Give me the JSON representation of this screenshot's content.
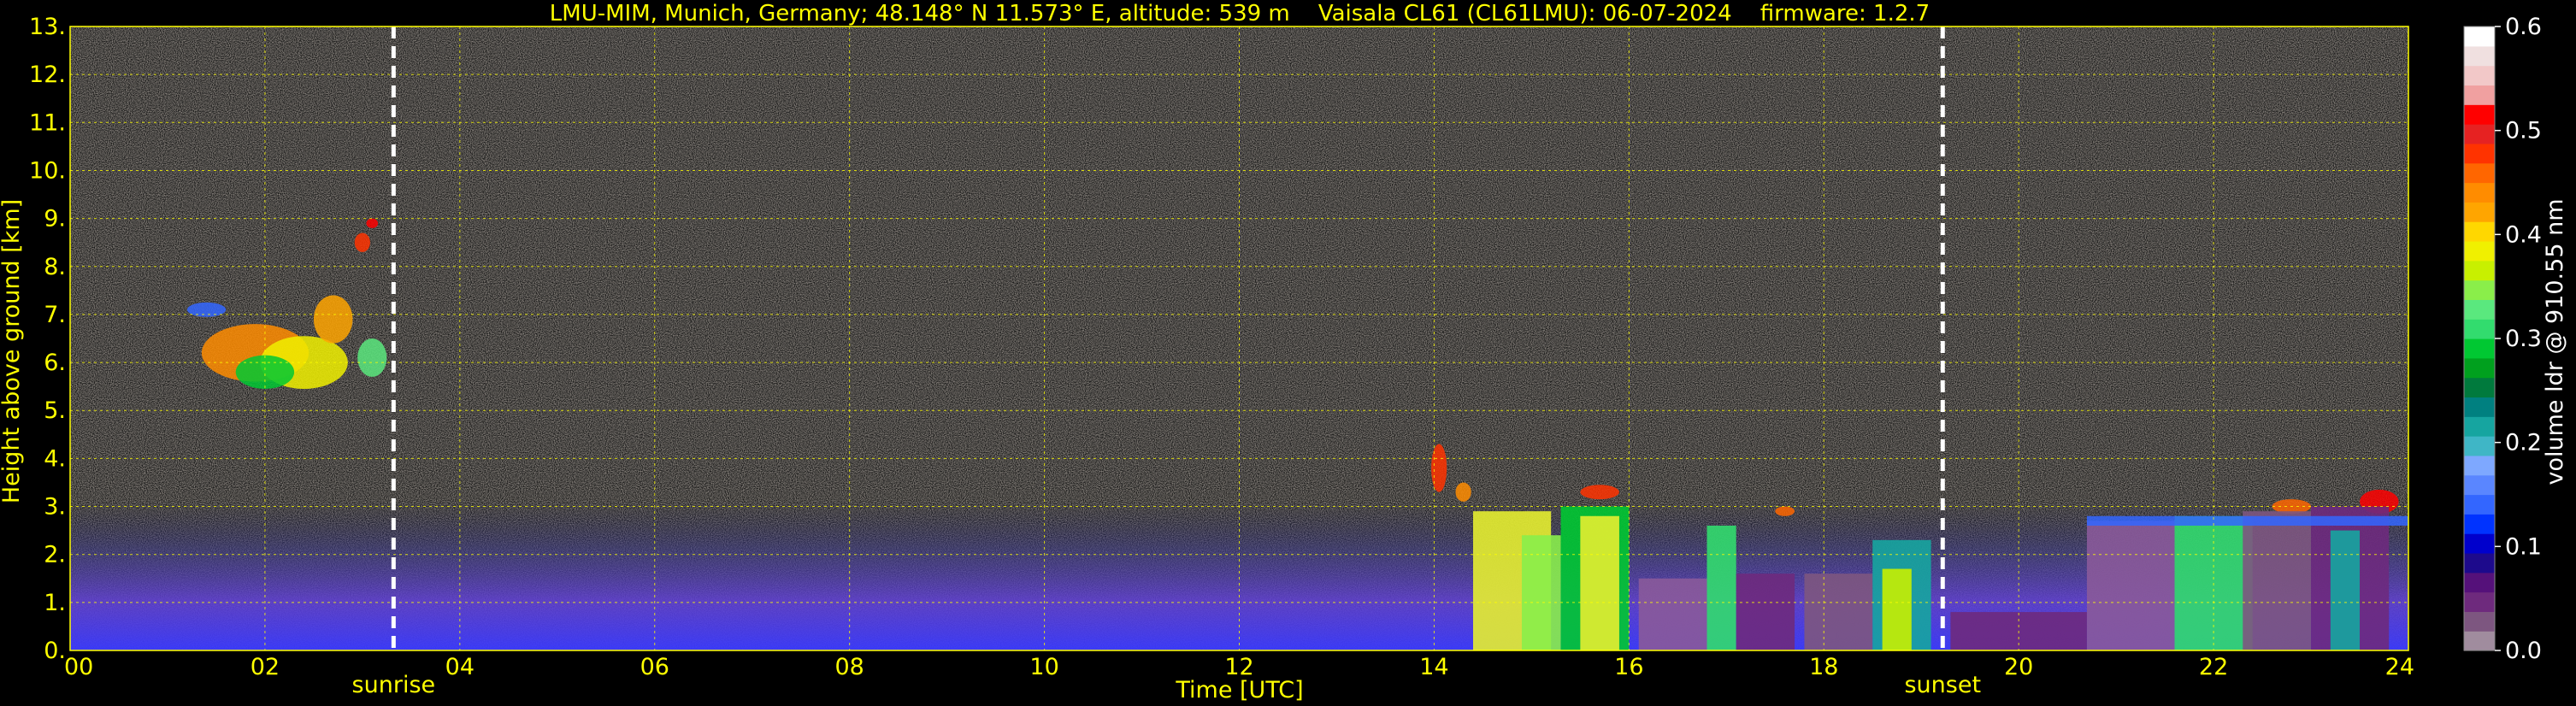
{
  "chart_data": {
    "type": "heatmap",
    "title": "LMU-MIM, Munich, Germany; 48.148° N 11.573° E, altitude: 539 m    Vaisala CL61 (CL61LMU): 06-07-2024    firmware: 1.2.7",
    "xlabel": "Time [UTC]",
    "ylabel": "Height above ground [km]",
    "xlim": [
      0,
      24
    ],
    "ylim": [
      0,
      13
    ],
    "x_ticks": [
      "00",
      "02",
      "04",
      "06",
      "08",
      "10",
      "12",
      "14",
      "16",
      "18",
      "20",
      "22",
      "24"
    ],
    "y_ticks": [
      "0.",
      "1.",
      "2.",
      "3.",
      "4.",
      "5.",
      "6.",
      "7.",
      "8.",
      "9.",
      "10.",
      "11.",
      "12.",
      "13."
    ],
    "grid": true,
    "events": [
      {
        "label": "sunrise",
        "x": 3.32
      },
      {
        "label": "sunset",
        "x": 19.22
      }
    ],
    "colorbar": {
      "label": "volume ldr @ 910.55 nm",
      "range": [
        0.0,
        0.6
      ],
      "ticks": [
        "0.0",
        "0.1",
        "0.2",
        "0.3",
        "0.4",
        "0.5",
        "0.6"
      ],
      "colors": [
        "#a08c9e",
        "#7d5680",
        "#6e2a7d",
        "#55117a",
        "#1d0a8c",
        "#0000cc",
        "#0033ff",
        "#3366ff",
        "#5a86ff",
        "#7ea8ff",
        "#3fb6c6",
        "#16a5a0",
        "#008080",
        "#007a3d",
        "#00a01e",
        "#00c832",
        "#32dc6e",
        "#5ae87e",
        "#8aee4a",
        "#c8f000",
        "#f0f000",
        "#ffd700",
        "#ffa500",
        "#ff8c00",
        "#ff6600",
        "#ff3300",
        "#e62222",
        "#ff0000",
        "#f0a0a0",
        "#f2c8c8",
        "#f0e0e0",
        "#ffffff"
      ]
    }
  }
}
